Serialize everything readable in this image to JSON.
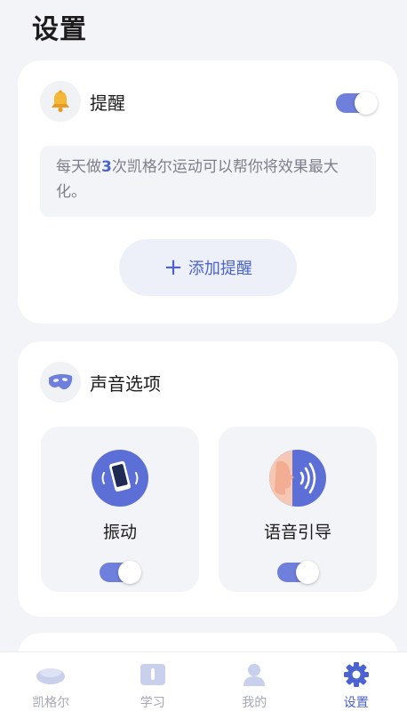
{
  "page": {
    "title": "设置"
  },
  "reminder": {
    "title": "提醒",
    "enabled": true,
    "info_prefix": "每天做",
    "info_count": "3",
    "info_suffix": "次凯格尔运动可以帮你将效果最大化。",
    "add_label": "添加提醒",
    "icon": "bell-icon"
  },
  "sound": {
    "title": "声音选项",
    "icon": "mask-icon",
    "options": [
      {
        "label": "振动",
        "enabled": true,
        "icon": "phone-vibrate-icon"
      },
      {
        "label": "语音引导",
        "enabled": true,
        "icon": "voice-guide-icon"
      }
    ]
  },
  "tabs": [
    {
      "label": "凯格尔",
      "icon": "pebble-icon",
      "active": false
    },
    {
      "label": "学习",
      "icon": "book-icon",
      "active": false
    },
    {
      "label": "我的",
      "icon": "user-icon",
      "active": false
    },
    {
      "label": "设置",
      "icon": "gear-icon",
      "active": true
    }
  ],
  "colors": {
    "accent": "#4a63d0",
    "toggle_on": "#6e7fdc",
    "background": "#f3f4f8",
    "inactive_tab": "#a5a8b4"
  }
}
